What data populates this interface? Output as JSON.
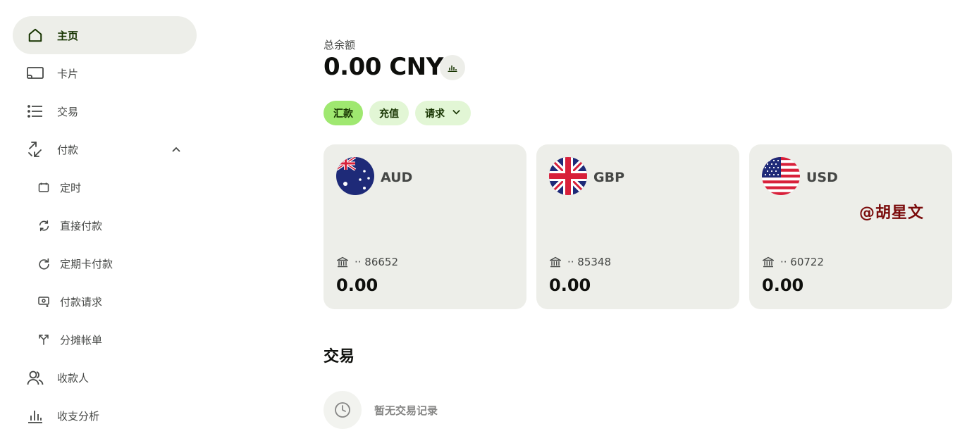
{
  "sidebar": {
    "items": [
      {
        "label": "主页",
        "icon": "home-icon",
        "active": true
      },
      {
        "label": "卡片",
        "icon": "card-icon"
      },
      {
        "label": "交易",
        "icon": "list-icon"
      },
      {
        "label": "付款",
        "icon": "transfer-icon",
        "expanded": true
      },
      {
        "label": "收款人",
        "icon": "recipients-icon"
      },
      {
        "label": "收支分析",
        "icon": "bar-chart-icon"
      }
    ],
    "payment_sub_items": [
      {
        "label": "定时",
        "icon": "calendar-icon"
      },
      {
        "label": "直接付款",
        "icon": "refresh-icon"
      },
      {
        "label": "定期卡付款",
        "icon": "redo-icon"
      },
      {
        "label": "付款请求",
        "icon": "request-money-icon"
      },
      {
        "label": "分摊帐单",
        "icon": "split-icon"
      }
    ]
  },
  "balance": {
    "label": "总余额",
    "amount": "0.00 CNY"
  },
  "actions": {
    "send": "汇款",
    "add": "充值",
    "request": "请求"
  },
  "accounts": [
    {
      "currency": "AUD",
      "account": "·· 86652",
      "balance": "0.00",
      "flag": "australia-flag-icon"
    },
    {
      "currency": "GBP",
      "account": "·· 85348",
      "balance": "0.00",
      "flag": "uk-flag-icon"
    },
    {
      "currency": "USD",
      "account": "·· 60722",
      "balance": "0.00",
      "flag": "us-flag-icon"
    }
  ],
  "watermark": "@胡星文",
  "transactions": {
    "title": "交易",
    "empty": "暂无交易记录"
  },
  "colors": {
    "accent_green": "#9fe870",
    "light_green": "#e2f6d5",
    "dark_green": "#163300",
    "card_bg": "#edeee9"
  }
}
